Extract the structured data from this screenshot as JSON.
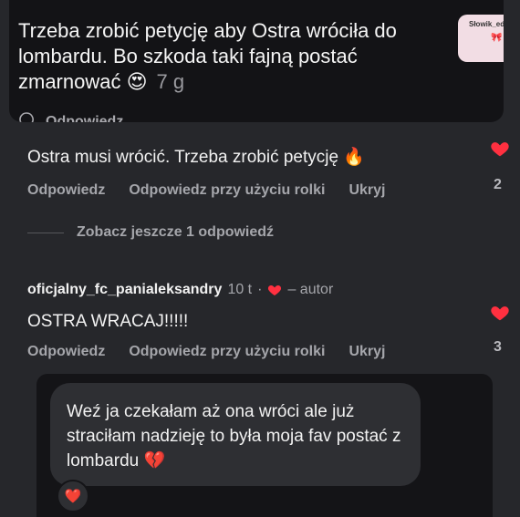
{
  "top_comment": {
    "text": "Trzeba zrobić petycję aby Ostra wróciła do lombardu. Bo szkoda taki fajną postać zmarnować 😍",
    "time": "7 g",
    "reply_peek": "Odpowiedz",
    "sticker_label": "Słowik_eda"
  },
  "comment1": {
    "text": "Ostra musi wrócić. Trzeba zrobić petycję 🔥",
    "actions": [
      "Odpowiedz",
      "Odpowiedz przy użyciu rolki",
      "Ukryj"
    ],
    "like_count": "2"
  },
  "see_more": {
    "label": "Zobacz jeszcze 1 odpowiedź"
  },
  "comment2": {
    "username": "oficjalny_fc_panialeksandry",
    "time": "10 t",
    "author_label": "– autor",
    "text": "OSTRA WRACAJ!!!!!",
    "actions": [
      "Odpowiedz",
      "Odpowiedz przy użyciu rolki",
      "Ukryj"
    ],
    "like_count": "3"
  },
  "reply_bubble": {
    "text": "Weź ja czekałam aż ona wróci ale już straciłam nadzieję to była moja fav postać z lombardu 💔",
    "reaction": "❤️"
  },
  "colors": {
    "background": "#26272b",
    "heart": "#ff3040",
    "secondary_text": "#a5a6ab"
  },
  "icons": [
    "heart-icon",
    "comment-icon",
    "heart-small-icon",
    "reaction-heart-icon"
  ]
}
